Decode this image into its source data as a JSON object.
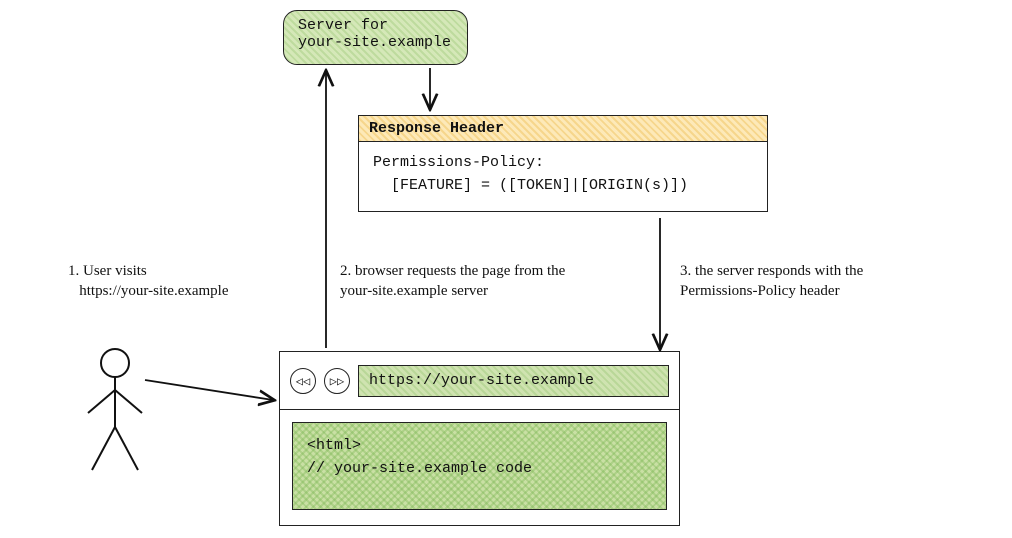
{
  "server": {
    "line1": "Server for",
    "line2": "your-site.example"
  },
  "response_header": {
    "title": "Response Header",
    "policy_key": "Permissions-Policy:",
    "policy_value": "[FEATURE] = ([TOKEN]|[ORIGIN(s)])"
  },
  "steps": {
    "s1_num": "1.",
    "s1_line1": "User visits",
    "s1_line2": "https://your-site.example",
    "s2_num": "2.",
    "s2_text": "browser requests the page from the your-site.example server",
    "s3_num": "3.",
    "s3_text": "the server responds with the Permissions-Policy header"
  },
  "browser": {
    "back_glyph": "◁◁",
    "fwd_glyph": "▷▷",
    "url": "https://your-site.example",
    "code_line1": "<html>",
    "code_line2": "// your-site.example code"
  }
}
